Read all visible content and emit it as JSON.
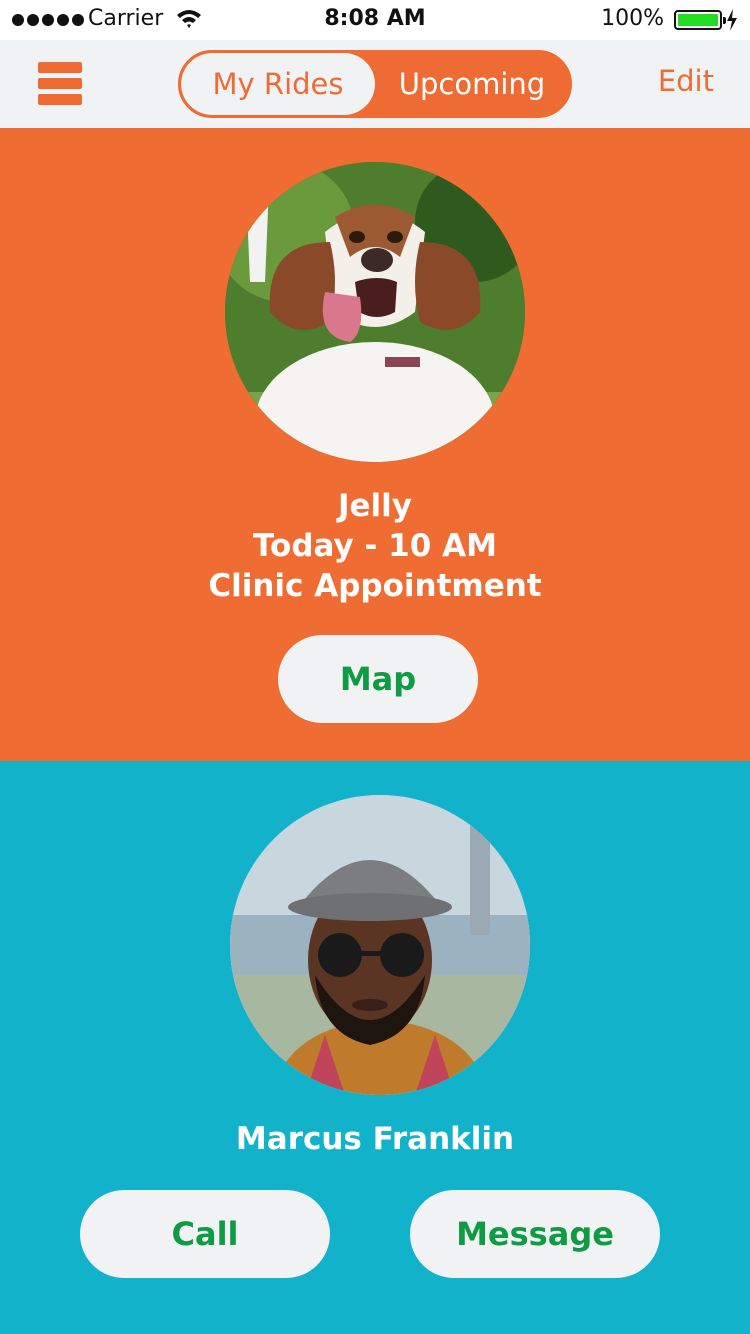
{
  "status_bar": {
    "carrier": "Carrier",
    "time": "8:08 AM",
    "battery": "100%",
    "signal_icon": "signal-dots-icon",
    "wifi_icon": "wifi-icon",
    "battery_icon": "battery-icon",
    "charging_icon": "charging-bolt-icon"
  },
  "nav": {
    "menu_icon": "hamburger-menu-icon",
    "tabs": [
      {
        "label": "My Rides",
        "active": true
      },
      {
        "label": "Upcoming",
        "active": false
      }
    ],
    "edit_label": "Edit"
  },
  "ride": {
    "name": "Jelly",
    "when": "Today - 10 AM",
    "purpose": "Clinic Appointment",
    "map_label": "Map",
    "photo": "dog-photo"
  },
  "driver": {
    "name": "Marcus Franklin",
    "call_label": "Call",
    "message_label": "Message",
    "photo": "driver-photo"
  },
  "colors": {
    "accent_orange": "#ef6c33",
    "teal": "#12b2cb",
    "button_text_green": "#0f9a44",
    "nav_bg": "#f1f2f4",
    "battery_green": "#22dd22"
  }
}
